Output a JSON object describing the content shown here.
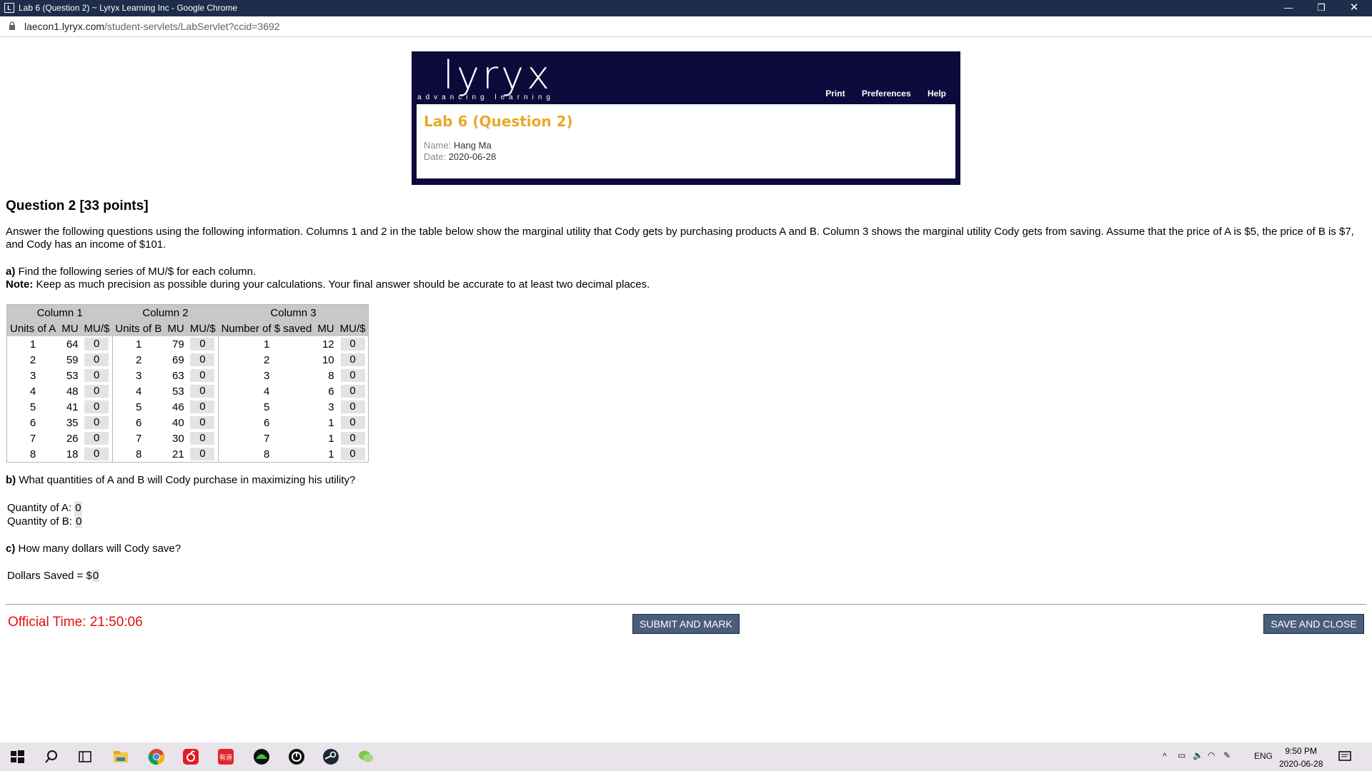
{
  "window": {
    "title": "Lab 6 (Question 2) ~ Lyryx Learning Inc - Google Chrome",
    "min": "—",
    "max": "❐",
    "close": "✕"
  },
  "address": {
    "host": "laecon1.lyryx.com",
    "path": "/student-servlets/LabServlet?ccid=3692"
  },
  "header": {
    "logo": "lyryx",
    "tagline": "advancing learning",
    "links": [
      "Print",
      "Preferences",
      "Help"
    ],
    "lab_title": "Lab 6 (Question 2)",
    "name_label": "Name:",
    "name": "Hang Ma",
    "date_label": "Date:",
    "date": "2020-06-28"
  },
  "question": {
    "title": "Question 2 [33 points]",
    "intro": "Answer the following questions using the following information. Columns 1 and 2 in the table below show the marginal utility that Cody gets by purchasing products A and B. Column 3 shows the marginal utility Cody gets from saving. Assume that the price of A is $5, the price of B is $7, and Cody has an income of $101.",
    "a_label": "a)",
    "a_text": " Find the following series of MU/$ for each column.",
    "note_label": "Note:",
    "note_text": " Keep as much precision as possible during your calculations. Your final answer should be accurate to at least two decimal places.",
    "b_label": "b)",
    "b_text": " What quantities of A and B will Cody purchase in maximizing his utility?",
    "qa_label": "Quantity of A:",
    "qa_value": "0",
    "qb_label": "Quantity of B:",
    "qb_value": "0",
    "c_label": "c)",
    "c_text": " How many dollars will Cody save?",
    "ds_label": "Dollars Saved = $",
    "ds_value": "0"
  },
  "table": {
    "group_headers": [
      "Column 1",
      "Column 2",
      "Column 3"
    ],
    "headers": [
      "Units of A",
      "MU",
      "MU/$",
      "Units of B",
      "MU",
      "MU/$",
      "Number of $ saved",
      "MU",
      "MU/$"
    ],
    "rows": [
      [
        "1",
        "64",
        "0",
        "1",
        "79",
        "0",
        "1",
        "12",
        "0"
      ],
      [
        "2",
        "59",
        "0",
        "2",
        "69",
        "0",
        "2",
        "10",
        "0"
      ],
      [
        "3",
        "53",
        "0",
        "3",
        "63",
        "0",
        "3",
        "8",
        "0"
      ],
      [
        "4",
        "48",
        "0",
        "4",
        "53",
        "0",
        "4",
        "6",
        "0"
      ],
      [
        "5",
        "41",
        "0",
        "5",
        "46",
        "0",
        "5",
        "3",
        "0"
      ],
      [
        "6",
        "35",
        "0",
        "6",
        "40",
        "0",
        "6",
        "1",
        "0"
      ],
      [
        "7",
        "26",
        "0",
        "7",
        "30",
        "0",
        "7",
        "1",
        "0"
      ],
      [
        "8",
        "18",
        "0",
        "8",
        "21",
        "0",
        "8",
        "1",
        "0"
      ]
    ]
  },
  "footer": {
    "official_time": "Official Time: 21:50:06",
    "submit": "SUBMIT AND MARK",
    "save": "SAVE AND CLOSE",
    "time_color": "#e01010"
  },
  "taskbar": {
    "lang": "ENG",
    "time": "9:50 PM",
    "date": "2020-06-28",
    "icons": [
      "windows-start-icon",
      "search-icon",
      "task-view-icon",
      "file-explorer-icon",
      "chrome-icon",
      "netease-music-icon",
      "youdao-icon",
      "iqiyi-icon",
      "uplay-icon",
      "steam-icon",
      "wechat-icon"
    ]
  }
}
